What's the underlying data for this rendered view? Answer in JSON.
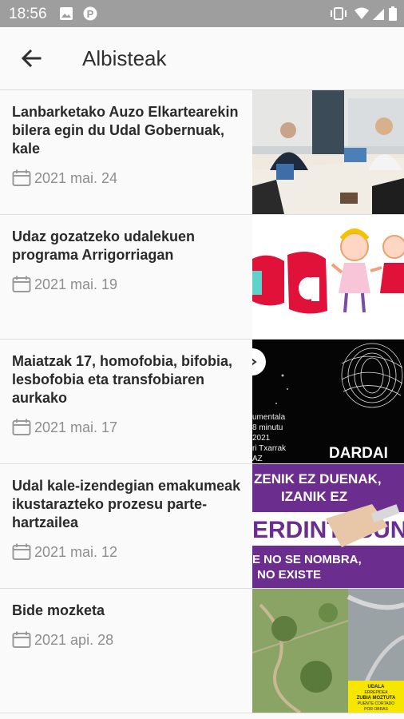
{
  "status": {
    "time": "18:56"
  },
  "appbar": {
    "title": "Albisteak"
  },
  "news": [
    {
      "headline": "Lanbarketako Auzo Elkartearekin bilera egin du Udal Gobernuak, kale",
      "date": "2021 mai. 24"
    },
    {
      "headline": "Udaz gozatzeko udalekuen programa Arrigorriagan",
      "date": "2021 mai. 19"
    },
    {
      "headline": "Maiatzak 17, homofobia, bifobia, lesbofobia eta transfobiaren aurkako",
      "date": "2021 mai. 17"
    },
    {
      "headline": "Udal kale-izendegian emakumeak ikustarazteko prozesu parte-hartzailea",
      "date": "2021 mai. 12"
    },
    {
      "headline": "Bide mozketa",
      "date": "2021 api. 28"
    }
  ],
  "thumb_text": {
    "t3_lines": [
      "umentala",
      "8 minutu",
      "2021",
      "ri Txarrak",
      "AZ"
    ],
    "t3_big": "DARDAI",
    "t4_top1": "ZENIK EZ DUENAK,",
    "t4_top2": "IZANIK EZ",
    "t4_mid": "ERDINTASUN",
    "t4_bot1": "E NO SE NOMBRA,",
    "t4_bot2": "NO EXISTE",
    "t5_sign1": "UDALA",
    "t5_sign2": "ERREPIDEA",
    "t5_sign3": "ZUBIA MOZTUTA",
    "t5_sign4": "PUENTE CORTADO",
    "t5_sign5": "POR OBRAS"
  }
}
